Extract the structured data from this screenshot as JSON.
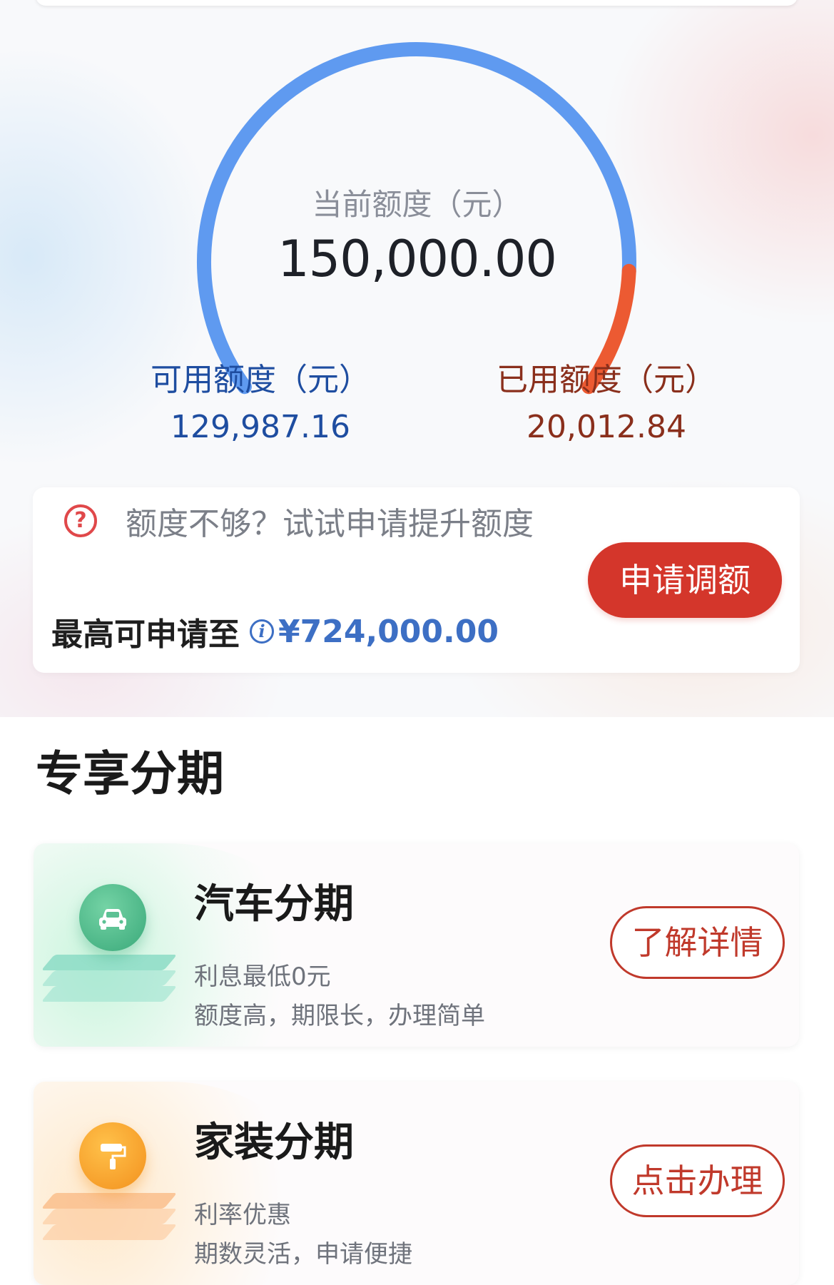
{
  "colors": {
    "gauge_available": "#5f9af0",
    "gauge_used": "#ec5a32",
    "available_text": "#1e4da0",
    "used_text": "#8a2f1c",
    "primary_red": "#d4362b",
    "link_blue": "#3d6fc4"
  },
  "gauge": {
    "label": "当前额度（元）",
    "value": "150,000.00",
    "used_fraction": 0.133
  },
  "available": {
    "label": "可用额度（元）",
    "value": "129,987.16"
  },
  "used": {
    "label": "已用额度（元）",
    "value": "20,012.84"
  },
  "raise_card": {
    "prompt": "额度不够？试试申请提升额度",
    "max_label": "最高可申请至",
    "max_value": "¥724,000.00",
    "button_label": "申请调额",
    "icons": [
      "question-circle-icon",
      "info-icon"
    ]
  },
  "section": {
    "title": "专享分期"
  },
  "products": [
    {
      "title": "汽车分期",
      "line1": "利息最低0元",
      "line2": "额度高，期限长，办理简单",
      "button_label": "了解详情",
      "icon": "car-icon",
      "accent": "#3aa97a"
    },
    {
      "title": "家装分期",
      "line1": "利率优惠",
      "line2": "期数灵活，申请便捷",
      "button_label": "点击办理",
      "icon": "paint-roller-icon",
      "accent": "#f3911e"
    }
  ]
}
